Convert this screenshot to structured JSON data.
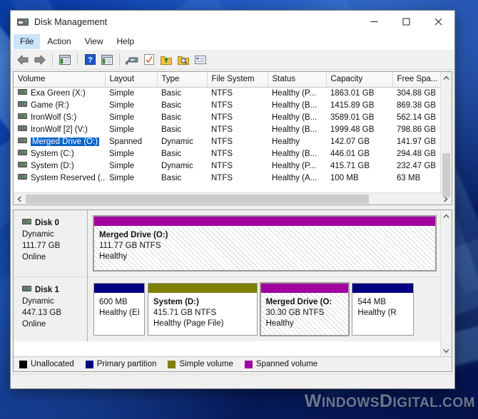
{
  "window": {
    "title": "Disk Management",
    "icon": "disk-drive-icon",
    "buttons": {
      "minimize": "—",
      "maximize": "☐",
      "close": "✕"
    }
  },
  "menubar": {
    "items": [
      {
        "label": "File",
        "active": true
      },
      {
        "label": "Action",
        "active": false
      },
      {
        "label": "View",
        "active": false
      },
      {
        "label": "Help",
        "active": false
      }
    ]
  },
  "toolbar": {
    "items": [
      {
        "name": "back-arrow-icon",
        "tip": "Back"
      },
      {
        "name": "forward-arrow-icon",
        "tip": "Forward"
      },
      {
        "name": "show-hide-console-tree-icon",
        "tip": "Show/Hide Console Tree"
      },
      {
        "name": "help-icon",
        "tip": "Help"
      },
      {
        "name": "show-hide-action-pane-icon",
        "tip": "Show/Hide Action Pane"
      },
      {
        "name": "rescan-disks-icon",
        "tip": "Rescan Disks"
      },
      {
        "name": "checklist-icon",
        "tip": "Properties"
      },
      {
        "name": "export-list-icon",
        "tip": "Export List"
      },
      {
        "name": "search-folder-icon",
        "tip": "Find"
      },
      {
        "name": "properties-icon",
        "tip": "Properties"
      }
    ]
  },
  "volume_list": {
    "columns": [
      "Volume",
      "Layout",
      "Type",
      "File System",
      "Status",
      "Capacity",
      "Free Spa..."
    ],
    "sort_indicator": "⌃",
    "rows": [
      {
        "volume": "Exa Green (X:)",
        "layout": "Simple",
        "type": "Basic",
        "fs": "NTFS",
        "status": "Healthy (P...",
        "capacity": "1863.01 GB",
        "free": "304.88 GB",
        "selected": false
      },
      {
        "volume": "Game (R:)",
        "layout": "Simple",
        "type": "Basic",
        "fs": "NTFS",
        "status": "Healthy (B...",
        "capacity": "1415.89 GB",
        "free": "869.38 GB",
        "selected": false
      },
      {
        "volume": "IronWolf (S:)",
        "layout": "Simple",
        "type": "Basic",
        "fs": "NTFS",
        "status": "Healthy (B...",
        "capacity": "3589.01 GB",
        "free": "562.14 GB",
        "selected": false
      },
      {
        "volume": "IronWolf [2] (V:)",
        "layout": "Simple",
        "type": "Basic",
        "fs": "NTFS",
        "status": "Healthy (B...",
        "capacity": "1999.48 GB",
        "free": "798.86 GB",
        "selected": false
      },
      {
        "volume": "Merged Drive (O:)",
        "layout": "Spanned",
        "type": "Dynamic",
        "fs": "NTFS",
        "status": "Healthy",
        "capacity": "142.07 GB",
        "free": "141.97 GB",
        "selected": true
      },
      {
        "volume": "System (C:)",
        "layout": "Simple",
        "type": "Basic",
        "fs": "NTFS",
        "status": "Healthy (B...",
        "capacity": "446.01 GB",
        "free": "294.48 GB",
        "selected": false
      },
      {
        "volume": "System (D:)",
        "layout": "Simple",
        "type": "Dynamic",
        "fs": "NTFS",
        "status": "Healthy (P...",
        "capacity": "415.71 GB",
        "free": "232.47 GB",
        "selected": false
      },
      {
        "volume": "System Reserved (...",
        "layout": "Simple",
        "type": "Basic",
        "fs": "NTFS",
        "status": "Healthy (A...",
        "capacity": "100 MB",
        "free": "63 MB",
        "selected": false
      }
    ]
  },
  "disks": [
    {
      "name": "Disk 0",
      "type": "Dynamic",
      "size": "111.77 GB",
      "state": "Online",
      "partitions": [
        {
          "title": "Merged Drive  (O:)",
          "line2": "111.77 GB NTFS",
          "line3": "Healthy",
          "color": "#a0009f",
          "width_pct": 100,
          "selected": true
        }
      ]
    },
    {
      "name": "Disk 1",
      "type": "Dynamic",
      "size": "447.13 GB",
      "state": "Online",
      "partitions": [
        {
          "title": "",
          "line2": "600 MB",
          "line3": "Healthy (EI",
          "color": "#000080",
          "width_pct": 15,
          "selected": false
        },
        {
          "title": "System  (D:)",
          "line2": "415.71 GB NTFS",
          "line3": "Healthy (Page File)",
          "color": "#808000",
          "width_pct": 32,
          "selected": false
        },
        {
          "title": "Merged Drive  (O:",
          "line2": "30.30 GB NTFS",
          "line3": "Healthy",
          "color": "#a0009f",
          "width_pct": 26,
          "selected": true
        },
        {
          "title": "",
          "line2": "544 MB",
          "line3": "Healthy (R",
          "color": "#000080",
          "width_pct": 18,
          "selected": false
        }
      ]
    }
  ],
  "legend": [
    {
      "label": "Unallocated",
      "color": "#000000"
    },
    {
      "label": "Primary partition",
      "color": "#000080"
    },
    {
      "label": "Simple volume",
      "color": "#808000"
    },
    {
      "label": "Spanned volume",
      "color": "#a0009f"
    }
  ],
  "watermark": {
    "big": "W",
    "text": "INDOWS",
    "big2": "D",
    "text2": "IGITAL.COM"
  }
}
